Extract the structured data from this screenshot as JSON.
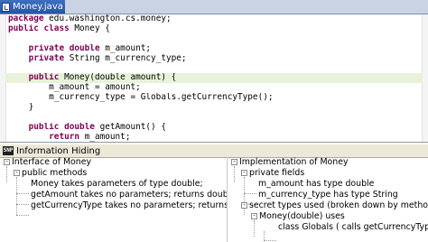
{
  "editor": {
    "tab_title": "Money.java",
    "tab_close": "x",
    "lines": [
      {
        "kw": "package",
        "rest": " edu.washington.cs.money;"
      },
      {
        "kw": "public class",
        "rest": " Money {"
      },
      {
        "kw": "",
        "rest": ""
      },
      {
        "kw": "    private double",
        "rest": " m_amount;"
      },
      {
        "kw": "    private",
        "rest": " String m_currency_type;"
      },
      {
        "kw": "",
        "rest": ""
      },
      {
        "kw": "    public",
        "rest": " Money(double amount) {"
      },
      {
        "kw": "",
        "rest": "        m_amount = amount;"
      },
      {
        "kw": "",
        "rest": "        m_currency_type = Globals.getCurrencyType();"
      },
      {
        "kw": "",
        "rest": "    }"
      },
      {
        "kw": "",
        "rest": ""
      },
      {
        "kw": "    public double",
        "rest": " getAmount() {"
      },
      {
        "kw": "        return",
        "rest": " m_amount;"
      }
    ]
  },
  "view": {
    "icon_text": "SNP",
    "title": "Information Hiding",
    "left_tree": [
      {
        "toggle": "-",
        "label": "Interface of Money"
      },
      {
        "toggle": "-",
        "label": "public methods"
      },
      {
        "toggle": "",
        "label": "Money takes parameters of type double;"
      },
      {
        "toggle": "",
        "label": "getAmount takes no parameters; returns double;"
      },
      {
        "toggle": "",
        "label": "getCurrencyType takes no parameters; returns String;"
      }
    ],
    "right_tree": [
      {
        "toggle": "-",
        "label": "Implementation of Money"
      },
      {
        "toggle": "-",
        "label": "private fields"
      },
      {
        "toggle": "",
        "label": "m_amount has type double"
      },
      {
        "toggle": "",
        "label": "m_currency_type has type String"
      },
      {
        "toggle": "-",
        "label": "secret types used (broken down by method)"
      },
      {
        "toggle": "-",
        "label": "Money(double) uses"
      },
      {
        "toggle": "",
        "label": "class Globals ( calls getCurrencyType )"
      }
    ]
  }
}
